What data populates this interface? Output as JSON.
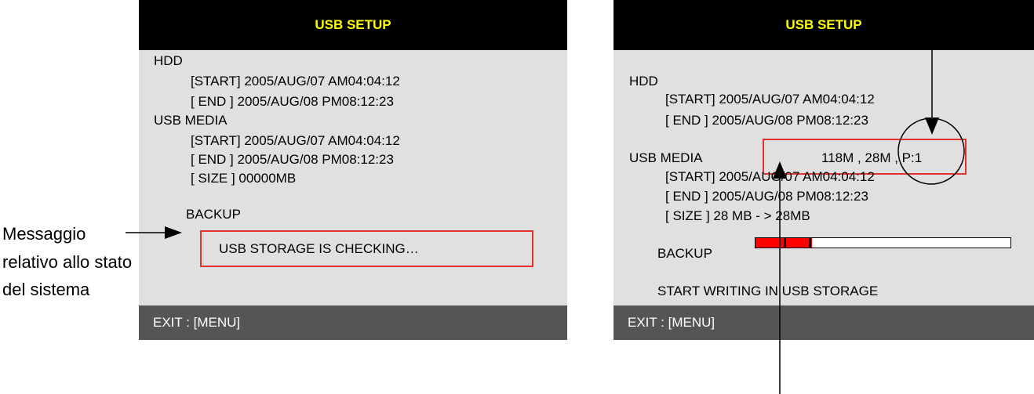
{
  "annotation": {
    "status_message_label": [
      "Messaggio",
      "relativo allo stato",
      "del sistema"
    ]
  },
  "left_panel": {
    "title": "USB SETUP",
    "hdd_label": "HDD",
    "hdd_start": "[START] 2005/AUG/07 AM04:04:12",
    "hdd_end": "[  END ] 2005/AUG/08 PM08:12:23",
    "usb_label": "USB MEDIA",
    "usb_start": "[START] 2005/AUG/07 AM04:04:12",
    "usb_end": "[  END ]  2005/AUG/08 PM08:12:23",
    "usb_size": "[ SIZE  ]   00000MB",
    "backup_label": "BACKUP",
    "status_message": "USB STORAGE IS CHECKING…",
    "footer": "EXIT : [MENU]"
  },
  "right_panel": {
    "title": "USB SETUP",
    "hdd_label": "HDD",
    "hdd_start": "[START] 2005/AUG/07 AM04:04:12",
    "hdd_end": "[  END ] 2005/AUG/08 PM08:12:23",
    "usb_label": "USB MEDIA",
    "usb_info": "118M , 28M , P:1",
    "usb_start": "[START] 2005/AUG/07 AM04:04:12",
    "usb_end": "[  END ] 2005/AUG/08 PM08:12:23",
    "usb_size": "[ SIZE  ] 28 MB - >  28MB",
    "backup_label": "BACKUP",
    "backup_progress": 0.22,
    "status_message": "START WRITING IN USB STORAGE",
    "footer": "EXIT : [MENU]"
  },
  "colors": {
    "header_bg": "#000000",
    "header_text": "#ffff00",
    "panel_bg": "#e0e0e0",
    "footer_bg": "#555555",
    "highlight": "#e53030",
    "progress_fill": "#ff0000"
  }
}
